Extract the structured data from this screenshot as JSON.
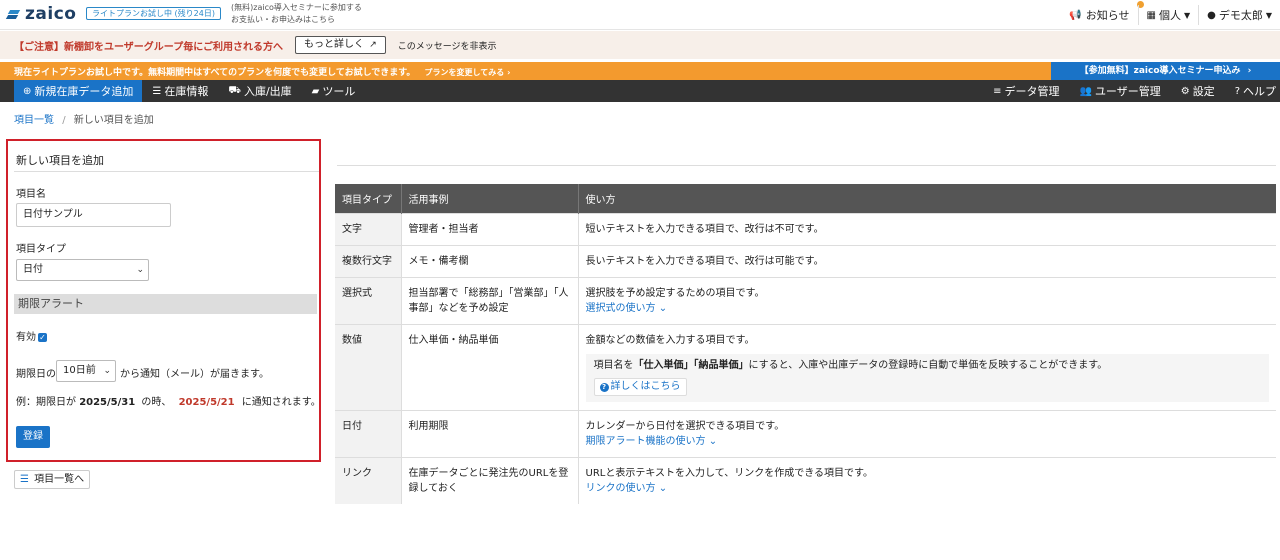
{
  "header": {
    "logo_text": "zaico",
    "trial_badge": "ライトプランお試し中 (残り24日)",
    "seminar_link": "(無料)zaico導入セミナーに参加する",
    "payment_link": "お支払い・お申込みはこちら",
    "notifications": "お知らせ",
    "account_type": "個人",
    "user_name": "デモ太郎"
  },
  "caution": {
    "message": "【ご注意】新棚卸をユーザーグループ毎にご利用される方へ",
    "more_button": "もっと詳しく",
    "hide_link": "このメッセージを非表示"
  },
  "trial_bar": {
    "message": "現在ライトプランお試し中です。無料期間中はすべてのプランを何度でも変更してお試しできます。",
    "change_plan": "プランを変更してみる",
    "seminar_button": "【参加無料】zaico導入セミナー申込み"
  },
  "nav": {
    "add_item": "新規在庫データ追加",
    "inventory": "在庫情報",
    "inout": "入庫/出庫",
    "tools": "ツール",
    "data_mgmt": "データ管理",
    "user_mgmt": "ユーザー管理",
    "settings": "設定",
    "help": "ヘルプ"
  },
  "breadcrumb": {
    "parent": "項目一覧",
    "sep": "/",
    "current": "新しい項目を追加"
  },
  "form": {
    "title": "新しい項目を追加",
    "name_label": "項目名",
    "name_value": "日付サンプル",
    "type_label": "項目タイプ",
    "type_value": "日付",
    "alert_section": "期限アラート",
    "enabled_label": "有効",
    "enabled_checked": true,
    "notify_prefix": "期限日の",
    "notify_value": "10日前",
    "notify_suffix": "から通知（メール）が届きます。",
    "example_prefix": "例：期限日が",
    "example_date": "2025/5/31",
    "example_mid": "の時、",
    "example_notify_date": "2025/5/21",
    "example_suffix": "に通知されます。",
    "submit": "登録",
    "back_button": "項目一覧へ"
  },
  "table": {
    "headers": [
      "項目タイプ",
      "活用事例",
      "使い方"
    ],
    "rows": [
      {
        "type": "文字",
        "example": "管理者・担当者",
        "usage": "短いテキストを入力できる項目で、改行は不可です。"
      },
      {
        "type": "複数行文字",
        "example": "メモ・備考欄",
        "usage": "長いテキストを入力できる項目で、改行は可能です。"
      },
      {
        "type": "選択式",
        "example": "担当部署で「総務部」「営業部」「人事部」などを予め設定",
        "usage": "選択肢を予め設定するための項目です。",
        "link": "選択式の使い方"
      },
      {
        "type": "数値",
        "example": "仕入単価・納品単価",
        "usage": "金額などの数値を入力する項目です。",
        "note_prefix": "項目名を",
        "note_b1": "「仕入単価」",
        "note_b2": "「納品単価」",
        "note_suffix": "にすると、入庫や出庫データの登録時に自動で単価を反映することができます。",
        "detail_button": "詳しくはこちら"
      },
      {
        "type": "日付",
        "example": "利用期限",
        "usage": "カレンダーから日付を選択できる項目です。",
        "link": "期限アラート機能の使い方"
      },
      {
        "type": "リンク",
        "example": "在庫データごとに発注先のURLを登録しておく",
        "usage": "URLと表示テキストを入力して、リンクを作成できる項目です。",
        "link": "リンクの使い方"
      }
    ]
  },
  "colors": {
    "primary": "#1a73c7",
    "orange": "#f39a2e",
    "alert_red": "#d0202a",
    "nav_bg": "#333333"
  }
}
